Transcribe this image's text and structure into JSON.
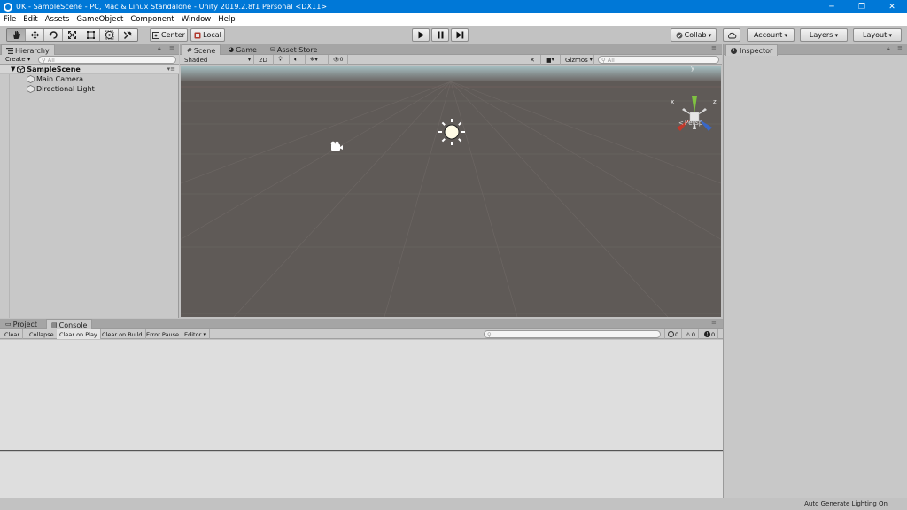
{
  "window": {
    "title": "UK - SampleScene - PC, Mac & Linux Standalone - Unity 2019.2.8f1 Personal <DX11>",
    "controls": {
      "minimize": "─",
      "maximize": "❐",
      "close": "✕"
    }
  },
  "menu": [
    "File",
    "Edit",
    "Assets",
    "GameObject",
    "Component",
    "Window",
    "Help"
  ],
  "toolbar": {
    "tools": [
      "hand-tool",
      "move-tool",
      "rotate-tool",
      "scale-tool",
      "rect-tool",
      "transform-tool",
      "custom-editor-tool"
    ],
    "active_tool": "hand-tool",
    "pivot_label": "Center",
    "space_label": "Local",
    "collab_label": "Collab",
    "account_label": "Account",
    "layers_label": "Layers",
    "layout_label": "Layout"
  },
  "hierarchy": {
    "tab_label": "Hierarchy",
    "create_label": "Create",
    "search_placeholder": "All",
    "scene_name": "SampleScene",
    "items": [
      {
        "label": "Main Camera"
      },
      {
        "label": "Directional Light"
      }
    ]
  },
  "scene": {
    "tabs": [
      "Scene",
      "Game",
      "Asset Store"
    ],
    "active_tab": "Scene",
    "shading_mode": "Shaded",
    "mode_2d": "2D",
    "effects_count": "0",
    "gizmos_label": "Gizmos",
    "search_placeholder": "All",
    "gizmo": {
      "x": "x",
      "y": "y",
      "z": "z",
      "projection": "Persp"
    }
  },
  "inspector": {
    "tab_label": "Inspector"
  },
  "console": {
    "tabs": [
      "Project",
      "Console"
    ],
    "active_tab": "Console",
    "buttons": {
      "clear": "Clear",
      "collapse": "Collapse",
      "clear_on_play": "Clear on Play",
      "clear_on_build": "Clear on Build",
      "error_pause": "Error Pause",
      "editor": "Editor"
    },
    "counts": {
      "info": "0",
      "warning": "0",
      "error": "0"
    }
  },
  "status": {
    "text": "Auto Generate Lighting On"
  },
  "colors": {
    "titlebar": "#0078d7",
    "viewport_ground": "#5f5a57",
    "sky": "#a8c3c6",
    "gizmo_x": "#c0392b",
    "gizmo_y": "#7fc241",
    "gizmo_z": "#3867c8"
  }
}
